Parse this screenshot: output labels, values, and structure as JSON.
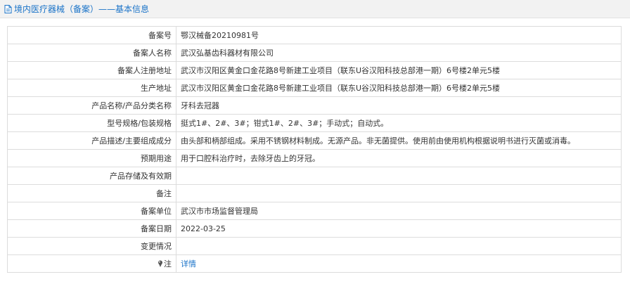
{
  "header": {
    "title": "境内医疗器械（备案）——基本信息",
    "icon": "document-icon"
  },
  "rows": [
    {
      "label": "备案号",
      "value": "鄂汉械备20210981号"
    },
    {
      "label": "备案人名称",
      "value": "武汉弘基齿科器材有限公司"
    },
    {
      "label": "备案人注册地址",
      "value": "武汉市汉阳区黄金口金花路8号新建工业项目（联东U谷汉阳科技总部港一期）6号楼2单元5楼"
    },
    {
      "label": "生产地址",
      "value": "武汉市汉阳区黄金口金花路8号新建工业项目（联东U谷汉阳科技总部港一期）6号楼2单元5楼"
    },
    {
      "label": "产品名称/产品分类名称",
      "value": "牙科去冠器"
    },
    {
      "label": "型号规格/包装规格",
      "value": "挺式1#、2#、3#；钳式1#、2#、3#；手动式；自动式。"
    },
    {
      "label": "产品描述/主要组成成分",
      "value": "由头部和柄部组成。采用不锈钢材料制成。无源产品。非无菌提供。使用前由使用机构根据说明书进行灭菌或消毒。"
    },
    {
      "label": "预期用途",
      "value": "用于口腔科治疗时，去除牙齿上的牙冠。"
    },
    {
      "label": "产品存储及有效期",
      "value": ""
    },
    {
      "label": "备注",
      "value": ""
    },
    {
      "label": "备案单位",
      "value": "武汉市市场监督管理局"
    },
    {
      "label": "备案日期",
      "value": "2022-03-25"
    },
    {
      "label": "变更情况",
      "value": ""
    }
  ],
  "note_row": {
    "label": "注",
    "icon": "pin-icon",
    "link_text": "详情",
    "link_color": "#1a73c8"
  }
}
